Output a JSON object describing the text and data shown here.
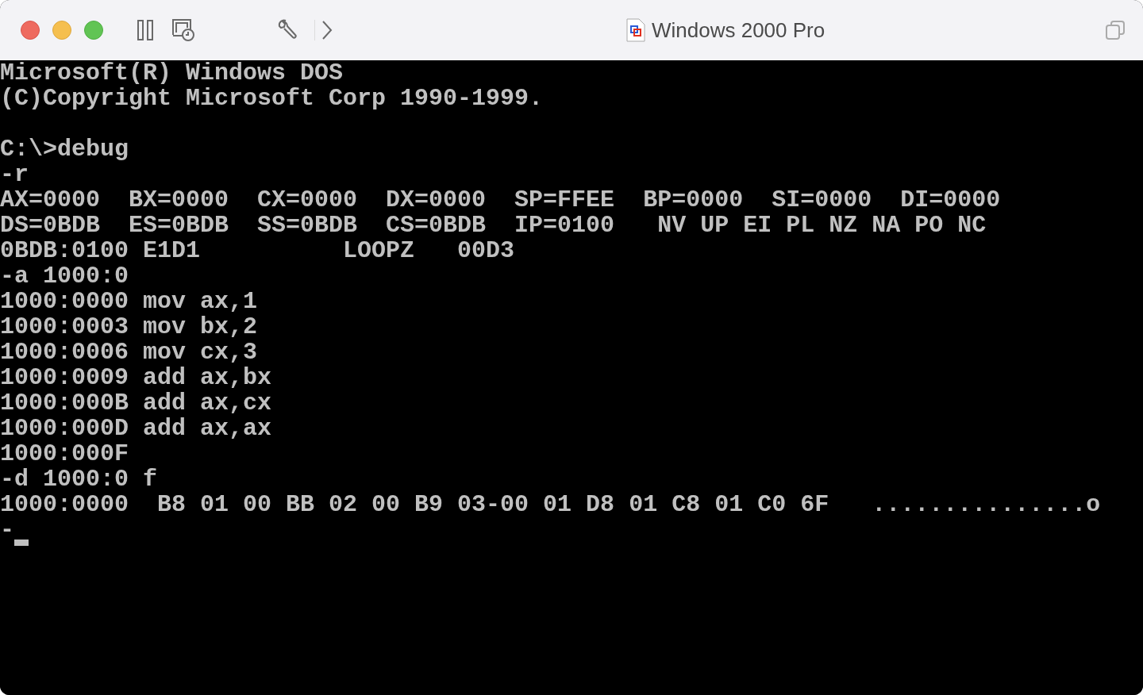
{
  "window": {
    "title": "Windows 2000 Pro"
  },
  "console": {
    "lines": [
      {
        "kind": "text",
        "text": "Microsoft(R) Windows DOS"
      },
      {
        "kind": "text",
        "text": "(C)Copyright Microsoft Corp 1990-1999."
      },
      {
        "kind": "blank"
      },
      {
        "kind": "text",
        "text": "C:\\>debug"
      },
      {
        "kind": "text",
        "text": "-r"
      },
      {
        "kind": "text",
        "text": "AX=0000  BX=0000  CX=0000  DX=0000  SP=FFEE  BP=0000  SI=0000  DI=0000"
      },
      {
        "kind": "text",
        "text": "DS=0BDB  ES=0BDB  SS=0BDB  CS=0BDB  IP=0100   NV UP EI PL NZ NA PO NC"
      },
      {
        "kind": "text",
        "text": "0BDB:0100 E1D1          LOOPZ   00D3"
      },
      {
        "kind": "text",
        "text": "-a 1000:0"
      },
      {
        "kind": "text",
        "text": "1000:0000 mov ax,1"
      },
      {
        "kind": "text",
        "text": "1000:0003 mov bx,2"
      },
      {
        "kind": "text",
        "text": "1000:0006 mov cx,3"
      },
      {
        "kind": "text",
        "text": "1000:0009 add ax,bx"
      },
      {
        "kind": "text",
        "text": "1000:000B add ax,cx"
      },
      {
        "kind": "text",
        "text": "1000:000D add ax,ax"
      },
      {
        "kind": "text",
        "text": "1000:000F"
      },
      {
        "kind": "text",
        "text": "-d 1000:0 f"
      },
      {
        "kind": "text",
        "text": "1000:0000  B8 01 00 BB 02 00 B9 03-00 01 D8 01 C8 01 C0 6F   ...............o"
      },
      {
        "kind": "prompt",
        "text": "-"
      }
    ]
  }
}
